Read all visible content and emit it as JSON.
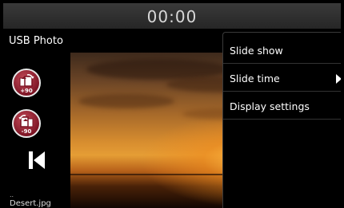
{
  "status_bar": {
    "clock": "00:00"
  },
  "header": {
    "title": "USB Photo"
  },
  "controls": {
    "rotate_right_label": "+90",
    "rotate_left_label": "-90",
    "icons": [
      "rotate-right-icon",
      "rotate-left-icon",
      "previous-icon",
      "submenu-arrow-icon"
    ]
  },
  "file": {
    "parent_dir": "..",
    "name": "Desert.jpg"
  },
  "menu": {
    "items": [
      {
        "label": "Slide show"
      },
      {
        "label": "Slide time"
      },
      {
        "label": "Display settings"
      }
    ]
  },
  "colors": {
    "accent": "#8a1a2a",
    "background": "#000000",
    "menu_divider": "#333333"
  }
}
